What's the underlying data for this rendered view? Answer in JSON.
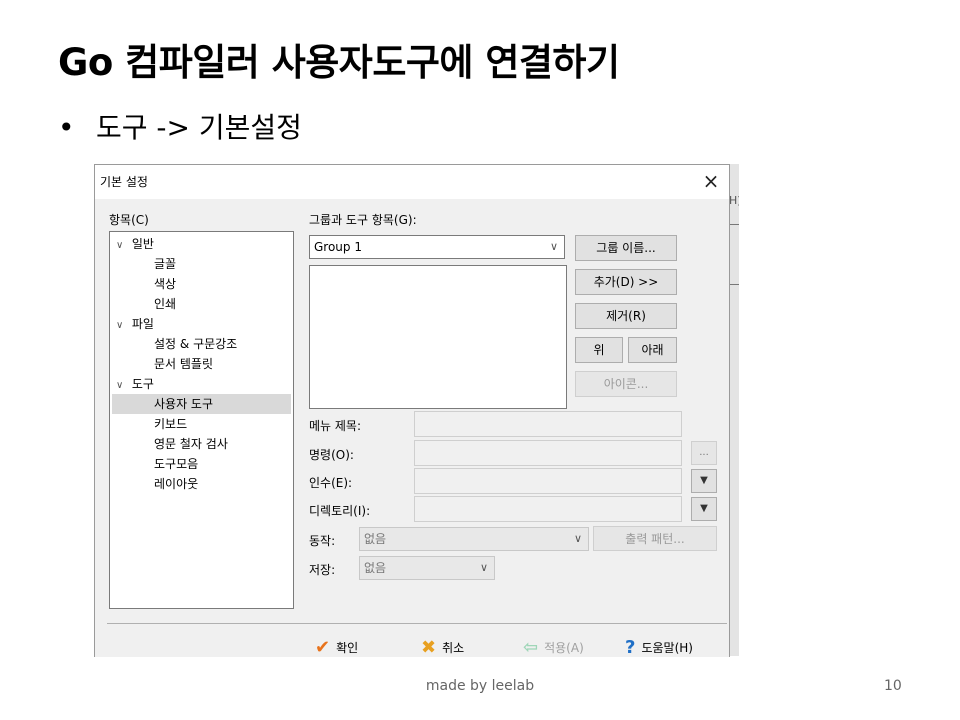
{
  "slide": {
    "title": "Go 컴파일러 사용자도구에 연결하기",
    "bullet_symbol": "•",
    "bullet_text": "도구 -> 기본설정",
    "footer": "made by leelab",
    "page_number": "10"
  },
  "dialog": {
    "title": "기본 설정",
    "close_symbol": "×",
    "background_strip_label": "H)",
    "tree_label": "항목(C)",
    "tree": [
      {
        "label": "일반",
        "expanded": true
      },
      {
        "label": "글꼴"
      },
      {
        "label": "색상"
      },
      {
        "label": "인쇄"
      },
      {
        "label": "파일",
        "expanded": true
      },
      {
        "label": "설정 & 구문강조"
      },
      {
        "label": "문서 템플릿"
      },
      {
        "label": "도구",
        "expanded": true
      },
      {
        "label": "사용자 도구",
        "selected": true
      },
      {
        "label": "키보드"
      },
      {
        "label": "영문 철자 검사"
      },
      {
        "label": "도구모음"
      },
      {
        "label": "레이아웃"
      }
    ],
    "group_label": "그룹과 도구 항목(G):",
    "group_value": "Group 1",
    "buttons": {
      "group_name": "그룹 이름...",
      "add": "추가(D) >>",
      "remove": "제거(R)",
      "up": "위",
      "down": "아래",
      "icon": "아이콘..."
    },
    "fields": {
      "menu_title": "메뉴 제목:",
      "command": "명령(O):",
      "arguments": "인수(E):",
      "directory": "디렉토리(I):",
      "ellipsis": "...",
      "dropdown_arrow": "▼"
    },
    "action_label": "동작:",
    "action_value": "없음",
    "output_pattern": "출력 패턴...",
    "save_label": "저장:",
    "save_value": "없음",
    "footer_buttons": {
      "ok": "확인",
      "cancel": "취소",
      "apply": "적용(A)",
      "help": "도움말(H)"
    },
    "colors": {
      "ok_icon": "#e8731c",
      "cancel_icon": "#e8a020",
      "apply_icon": "#9fd6b8",
      "help_icon": "#1f6fc6",
      "selection": "#d9d9d9"
    }
  }
}
